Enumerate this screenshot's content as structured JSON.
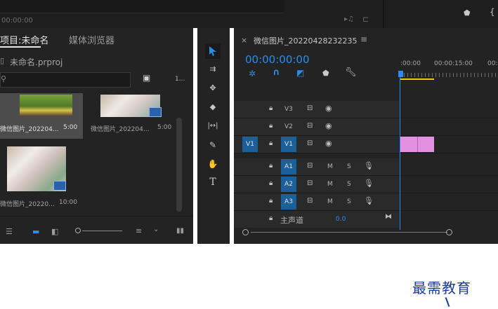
{
  "top_panel": {
    "timecode": "00:00:00"
  },
  "project": {
    "title": "项目:未命名",
    "tab_media": "媒体浏览器",
    "file": "未命名.prproj",
    "count_label": "1..."
  },
  "clips": [
    {
      "name": "微信图片_202204...",
      "duration": "5:00"
    },
    {
      "name": "微信图片_202204...",
      "duration": "5:00"
    },
    {
      "name": "微信图片_20220...",
      "duration": "10:00"
    }
  ],
  "sequence": {
    "title": "微信图片_20220428232235",
    "timecode": "00:00:00:00",
    "ruler": [
      ":00:00",
      "00:00:15:00",
      "00:"
    ]
  },
  "tracks": {
    "v": [
      {
        "label": "V3"
      },
      {
        "label": "V2"
      },
      {
        "label": "V1",
        "src": "V1"
      }
    ],
    "a": [
      {
        "label": "A1"
      },
      {
        "label": "A2"
      },
      {
        "label": "A3"
      }
    ],
    "m": "M",
    "s": "S",
    "master": {
      "label": "主声道",
      "value": "0.0"
    }
  },
  "watermark": "最需教育",
  "colors": {
    "accent": "#2d8ceb",
    "clip_pink": "#e390e3",
    "track_blue": "#1c5f99",
    "work_area": "#e3d000"
  }
}
